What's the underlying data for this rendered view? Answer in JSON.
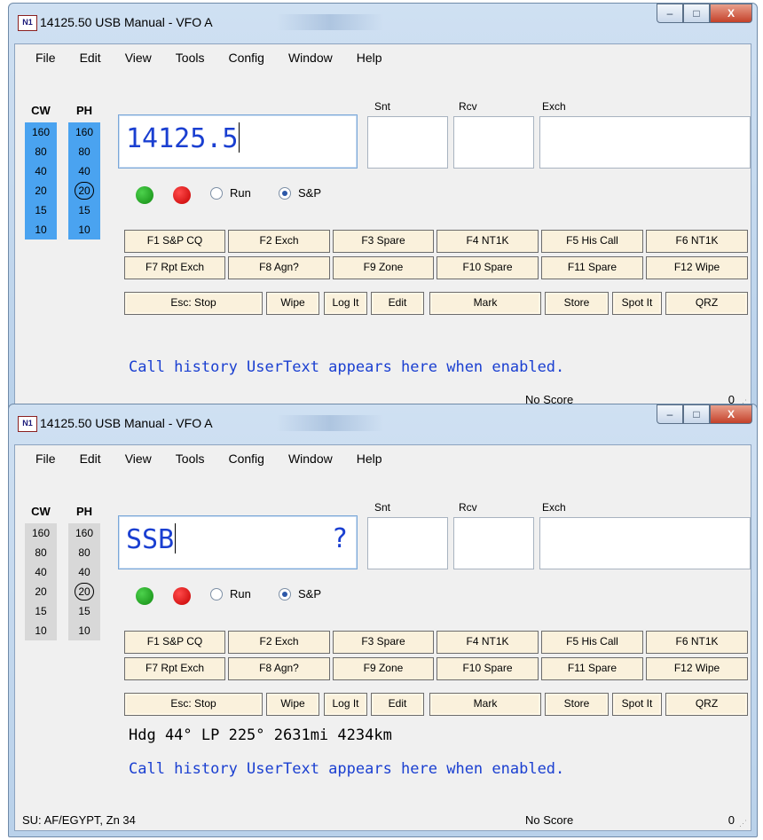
{
  "windows": [
    {
      "title": "14125.50 USB Manual - VFO A",
      "app_icon": "N1MM-logo",
      "caption_buttons": {
        "minimize": "–",
        "maximize": "□",
        "close": "X"
      },
      "menu": [
        "File",
        "Edit",
        "View",
        "Tools",
        "Config",
        "Window",
        "Help"
      ],
      "bands": {
        "cw_header": "CW",
        "ph_header": "PH",
        "cw": [
          "160",
          "80",
          "40",
          "20",
          "15",
          "10"
        ],
        "ph": [
          "160",
          "80",
          "40",
          "20",
          "15",
          "10"
        ],
        "selected_ph": "20",
        "band_bg": "#4aa3f0"
      },
      "labels": {
        "snt": "Snt",
        "rcv": "Rcv",
        "exch": "Exch"
      },
      "callsign": {
        "value": "14125.5",
        "question": ""
      },
      "snt_value": "",
      "rcv_value": "",
      "exch_value": "",
      "radio": {
        "run": "Run",
        "sp": "S&P",
        "selected": "S&P"
      },
      "fkeys_row1": [
        "F1 S&P CQ",
        "F2 Exch",
        "F3 Spare",
        "F4 NT1K",
        "F5 His Call",
        "F6 NT1K"
      ],
      "fkeys_row2": [
        "F7 Rpt Exch",
        "F8 Agn?",
        "F9 Zone",
        "F10 Spare",
        "F11 Spare",
        "F12 Wipe"
      ],
      "buttons_row3": [
        "Esc: Stop",
        "Wipe",
        "Log It",
        "Edit",
        "Mark",
        "Store",
        "Spot It",
        "QRZ"
      ],
      "heading": "",
      "usertext": "Call history UserText appears here when enabled.",
      "status": {
        "left": "",
        "score": "No Score",
        "count": "0"
      }
    },
    {
      "title": "14125.50 USB Manual - VFO A",
      "app_icon": "N1MM-logo",
      "caption_buttons": {
        "minimize": "–",
        "maximize": "□",
        "close": "X"
      },
      "menu": [
        "File",
        "Edit",
        "View",
        "Tools",
        "Config",
        "Window",
        "Help"
      ],
      "bands": {
        "cw_header": "CW",
        "ph_header": "PH",
        "cw": [
          "160",
          "80",
          "40",
          "20",
          "15",
          "10"
        ],
        "ph": [
          "160",
          "80",
          "40",
          "20",
          "15",
          "10"
        ],
        "selected_ph": "20",
        "band_bg": "#d8d8d8"
      },
      "labels": {
        "snt": "Snt",
        "rcv": "Rcv",
        "exch": "Exch"
      },
      "callsign": {
        "value": "SSB",
        "question": "?"
      },
      "snt_value": "",
      "rcv_value": "",
      "exch_value": "",
      "radio": {
        "run": "Run",
        "sp": "S&P",
        "selected": "S&P"
      },
      "fkeys_row1": [
        "F1 S&P CQ",
        "F2 Exch",
        "F3 Spare",
        "F4 NT1K",
        "F5 His Call",
        "F6 NT1K"
      ],
      "fkeys_row2": [
        "F7 Rpt Exch",
        "F8 Agn?",
        "F9 Zone",
        "F10 Spare",
        "F11 Spare",
        "F12 Wipe"
      ],
      "buttons_row3": [
        "Esc: Stop",
        "Wipe",
        "Log It",
        "Edit",
        "Mark",
        "Store",
        "Spot It",
        "QRZ"
      ],
      "heading": "Hdg 44° LP 225° 2631mi 4234km",
      "usertext": "Call history UserText appears here when enabled.",
      "status": {
        "left": "SU: AF/EGYPT, Zn 34",
        "score": "No Score",
        "count": "0"
      }
    }
  ]
}
